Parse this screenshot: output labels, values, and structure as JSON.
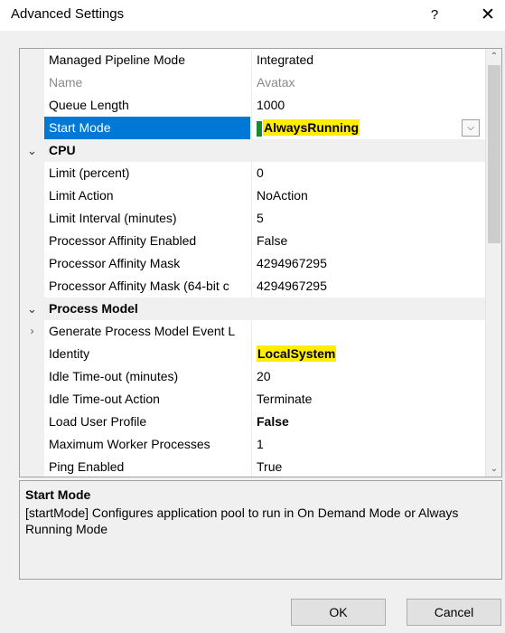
{
  "window": {
    "title": "Advanced Settings",
    "help_glyph": "?",
    "close_glyph": "✕"
  },
  "grid": {
    "rows": [
      {
        "kind": "prop",
        "name": "Managed Pipeline Mode",
        "value": "Integrated"
      },
      {
        "kind": "prop",
        "name": "Name",
        "value": "Avatax",
        "disabled": true
      },
      {
        "kind": "prop",
        "name": "Queue Length",
        "value": "1000"
      },
      {
        "kind": "prop",
        "name": "Start Mode",
        "value": "AlwaysRunning",
        "selected": true,
        "highlighted": true
      },
      {
        "kind": "category",
        "name": "CPU",
        "expander": "⌄"
      },
      {
        "kind": "prop",
        "name": "Limit (percent)",
        "value": "0"
      },
      {
        "kind": "prop",
        "name": "Limit Action",
        "value": "NoAction"
      },
      {
        "kind": "prop",
        "name": "Limit Interval (minutes)",
        "value": "5"
      },
      {
        "kind": "prop",
        "name": "Processor Affinity Enabled",
        "value": "False"
      },
      {
        "kind": "prop",
        "name": "Processor Affinity Mask",
        "value": "4294967295"
      },
      {
        "kind": "prop",
        "name": "Processor Affinity Mask (64-bit c",
        "value": "4294967295"
      },
      {
        "kind": "category",
        "name": "Process Model",
        "expander": "⌄"
      },
      {
        "kind": "prop",
        "name": "Generate Process Model Event L",
        "value": "",
        "expander": "›"
      },
      {
        "kind": "prop",
        "name": "Identity",
        "value": "LocalSystem",
        "highlighted": true
      },
      {
        "kind": "prop",
        "name": "Idle Time-out (minutes)",
        "value": "20"
      },
      {
        "kind": "prop",
        "name": "Idle Time-out Action",
        "value": "Terminate"
      },
      {
        "kind": "prop",
        "name": "Load User Profile",
        "value": "False",
        "bold": true
      },
      {
        "kind": "prop",
        "name": "Maximum Worker Processes",
        "value": "1"
      },
      {
        "kind": "prop",
        "name": "Ping Enabled",
        "value": "True"
      }
    ],
    "dropdown_glyph": "⌵"
  },
  "scrollbar": {
    "up_glyph": "⌃",
    "down_glyph": "⌄"
  },
  "description": {
    "title": "Start Mode",
    "text": "[startMode] Configures application pool to run in On Demand Mode or Always Running Mode"
  },
  "buttons": {
    "ok": "OK",
    "cancel": "Cancel"
  }
}
